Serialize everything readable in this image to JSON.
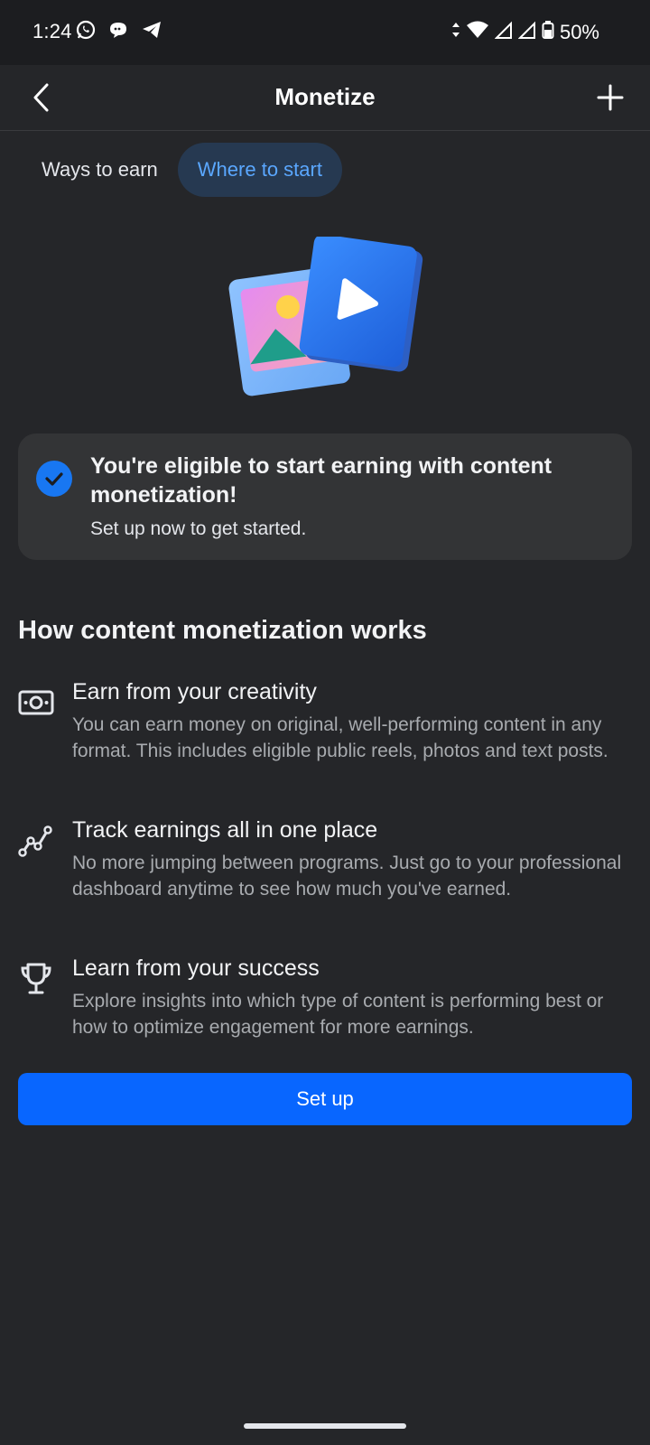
{
  "status_bar": {
    "time": "1:24",
    "battery": "50%",
    "icons": [
      "whatsapp-icon",
      "chat-icon",
      "telegram-icon",
      "data-arrows-icon",
      "wifi-icon",
      "signal-icon",
      "signal-icon",
      "battery-icon"
    ]
  },
  "app_bar": {
    "title": "Monetize",
    "back_icon": "chevron-left-icon",
    "add_icon": "plus-icon"
  },
  "tabs": [
    {
      "label": "Ways to earn",
      "active": false
    },
    {
      "label": "Where to start",
      "active": true
    }
  ],
  "eligibility": {
    "title": "You're eligible to start earning with content monetization!",
    "subtitle": "Set up now to get started."
  },
  "section": {
    "heading": "How content monetization works",
    "features": [
      {
        "icon": "money-icon",
        "title": "Earn from your creativity",
        "description": "You can earn money on original, well-performing content in any format. This includes eligible public reels, photos and text posts."
      },
      {
        "icon": "trend-line-icon",
        "title": "Track earnings all in one place",
        "description": "No more jumping between programs. Just go to your professional dashboard anytime to see how much you've earned."
      },
      {
        "icon": "trophy-icon",
        "title": "Learn from your success",
        "description": "Explore insights into which type of content is performing best or how to optimize engagement for more earnings."
      }
    ]
  },
  "actions": {
    "setup_label": "Set up"
  },
  "colors": {
    "background": "#252629",
    "accent": "#0866ff",
    "active_tab_bg": "#263951",
    "active_tab_text": "#5aa7ff",
    "card_bg": "#333436"
  }
}
